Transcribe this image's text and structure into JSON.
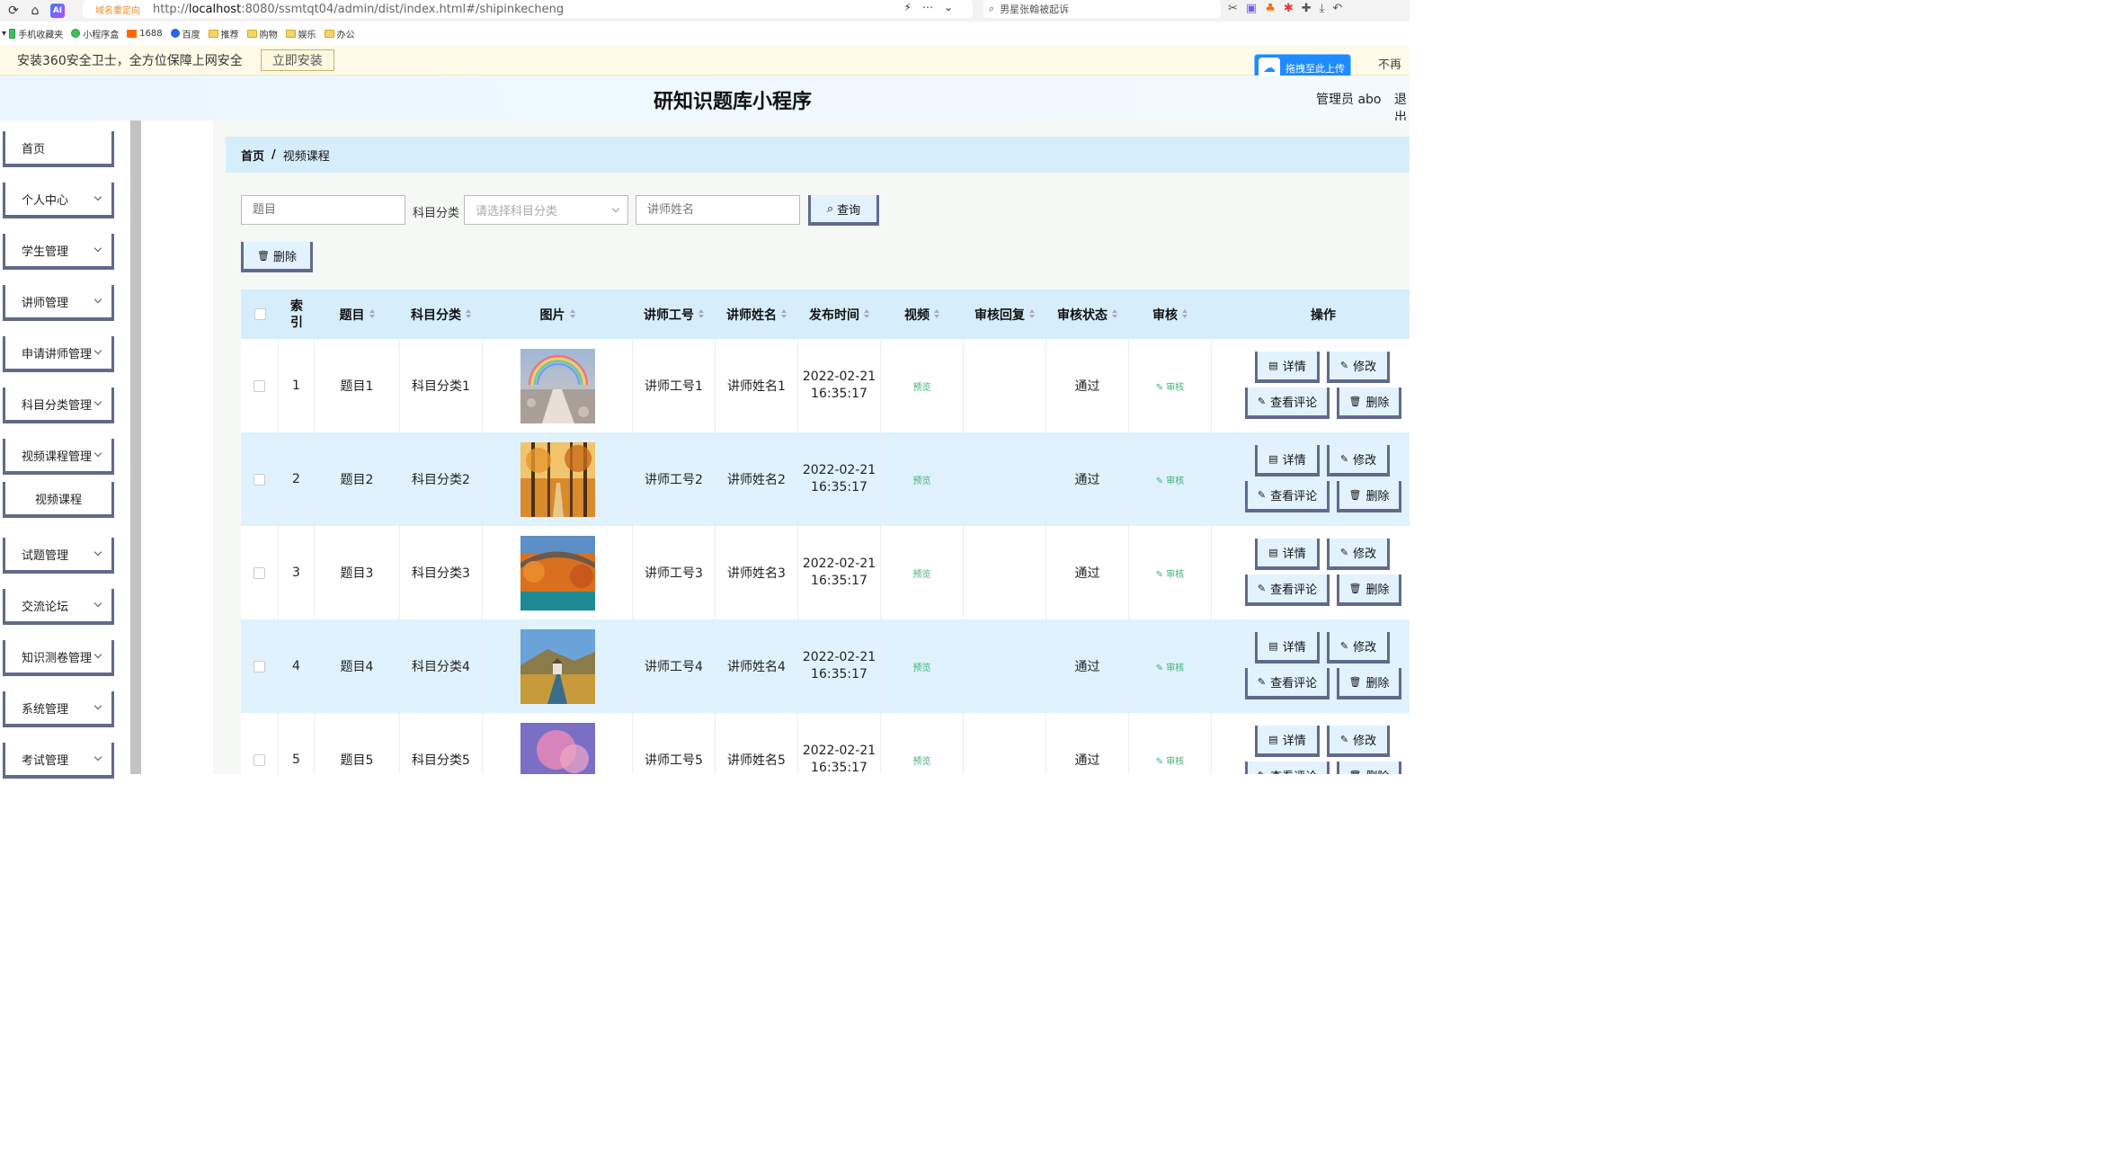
{
  "browser": {
    "redirect_tag": "域名重定向",
    "url_prefix": "http://",
    "url_host": "localhost",
    "url_rest": ":8080/ssmtqt04/admin/dist/index.html#/shipinkecheng",
    "search_text": "男星张翰被起诉"
  },
  "bookmarks": [
    {
      "label": "手机收藏夹",
      "icon": "phone-icon"
    },
    {
      "label": "小程序盒",
      "icon": "miniapp-icon"
    },
    {
      "label": "1688",
      "icon": "1688-icon"
    },
    {
      "label": "百度",
      "icon": "baidu-icon"
    },
    {
      "label": "推荐",
      "icon": "folder-icon"
    },
    {
      "label": "购物",
      "icon": "folder-icon"
    },
    {
      "label": "娱乐",
      "icon": "folder-icon"
    },
    {
      "label": "办公",
      "icon": "folder-icon"
    }
  ],
  "notice": {
    "text": "安装360安全卫士，全方位保障上网安全",
    "install_label": "立即安装",
    "upload_label": "拖拽至此上传",
    "dismiss_label": "不再提"
  },
  "header": {
    "title": "研知识题库小程序",
    "admin": "管理员 abo",
    "logout": "退出"
  },
  "sidebar": {
    "items": [
      {
        "label": "首页",
        "has_chevron": false
      },
      {
        "label": "个人中心",
        "has_chevron": true
      },
      {
        "label": "学生管理",
        "has_chevron": true
      },
      {
        "label": "讲师管理",
        "has_chevron": true
      },
      {
        "label": "申请讲师管理",
        "has_chevron": true
      },
      {
        "label": "科目分类管理",
        "has_chevron": true
      },
      {
        "label": "视频课程管理",
        "has_chevron": true
      },
      {
        "label": "视频课程",
        "has_chevron": false,
        "sub": true
      },
      {
        "label": "试题管理",
        "has_chevron": true
      },
      {
        "label": "交流论坛",
        "has_chevron": true
      },
      {
        "label": "知识测卷管理",
        "has_chevron": true
      },
      {
        "label": "系统管理",
        "has_chevron": true
      },
      {
        "label": "考试管理",
        "has_chevron": true
      }
    ]
  },
  "breadcrumb": {
    "home": "首页",
    "sep": "/",
    "current": "视频课程"
  },
  "search": {
    "title_placeholder": "题目",
    "subject_label": "科目分类",
    "subject_placeholder": "请选择科目分类",
    "teacher_placeholder": "讲师姓名",
    "query_label": "查询",
    "delete_label": "删除"
  },
  "table": {
    "columns": {
      "index": "索引",
      "title": "题目",
      "subject": "科目分类",
      "image": "图片",
      "teacher_no": "讲师工号",
      "teacher_name": "讲师姓名",
      "publish_time": "发布时间",
      "video": "视频",
      "review_reply": "审核回复",
      "review_status": "审核状态",
      "review": "审核",
      "actions": "操作"
    },
    "rows": [
      {
        "index": "1",
        "title": "题目1",
        "subject": "科目分类1",
        "teacher_no": "讲师工号1",
        "teacher_name": "讲师姓名1",
        "date": "2022-02-21",
        "time": "16:35:17",
        "video": "预览",
        "reply": "",
        "status": "通过",
        "review": "审核"
      },
      {
        "index": "2",
        "title": "题目2",
        "subject": "科目分类2",
        "teacher_no": "讲师工号2",
        "teacher_name": "讲师姓名2",
        "date": "2022-02-21",
        "time": "16:35:17",
        "video": "预览",
        "reply": "",
        "status": "通过",
        "review": "审核"
      },
      {
        "index": "3",
        "title": "题目3",
        "subject": "科目分类3",
        "teacher_no": "讲师工号3",
        "teacher_name": "讲师姓名3",
        "date": "2022-02-21",
        "time": "16:35:17",
        "video": "预览",
        "reply": "",
        "status": "通过",
        "review": "审核"
      },
      {
        "index": "4",
        "title": "题目4",
        "subject": "科目分类4",
        "teacher_no": "讲师工号4",
        "teacher_name": "讲师姓名4",
        "date": "2022-02-21",
        "time": "16:35:17",
        "video": "预览",
        "reply": "",
        "status": "通过",
        "review": "审核"
      },
      {
        "index": "5",
        "title": "题目5",
        "subject": "科目分类5",
        "teacher_no": "讲师工号5",
        "teacher_name": "讲师姓名5",
        "date": "2022-02-21",
        "time": "16:35:17",
        "video": "预览",
        "reply": "",
        "status": "通过",
        "review": "审核"
      }
    ],
    "action_labels": {
      "detail": "详情",
      "edit": "修改",
      "comments": "查看评论",
      "delete": "删除"
    }
  },
  "colors": {
    "accent_blue": "#d6eefc",
    "button_border": "#626a8a",
    "success_green": "#3cb371"
  }
}
